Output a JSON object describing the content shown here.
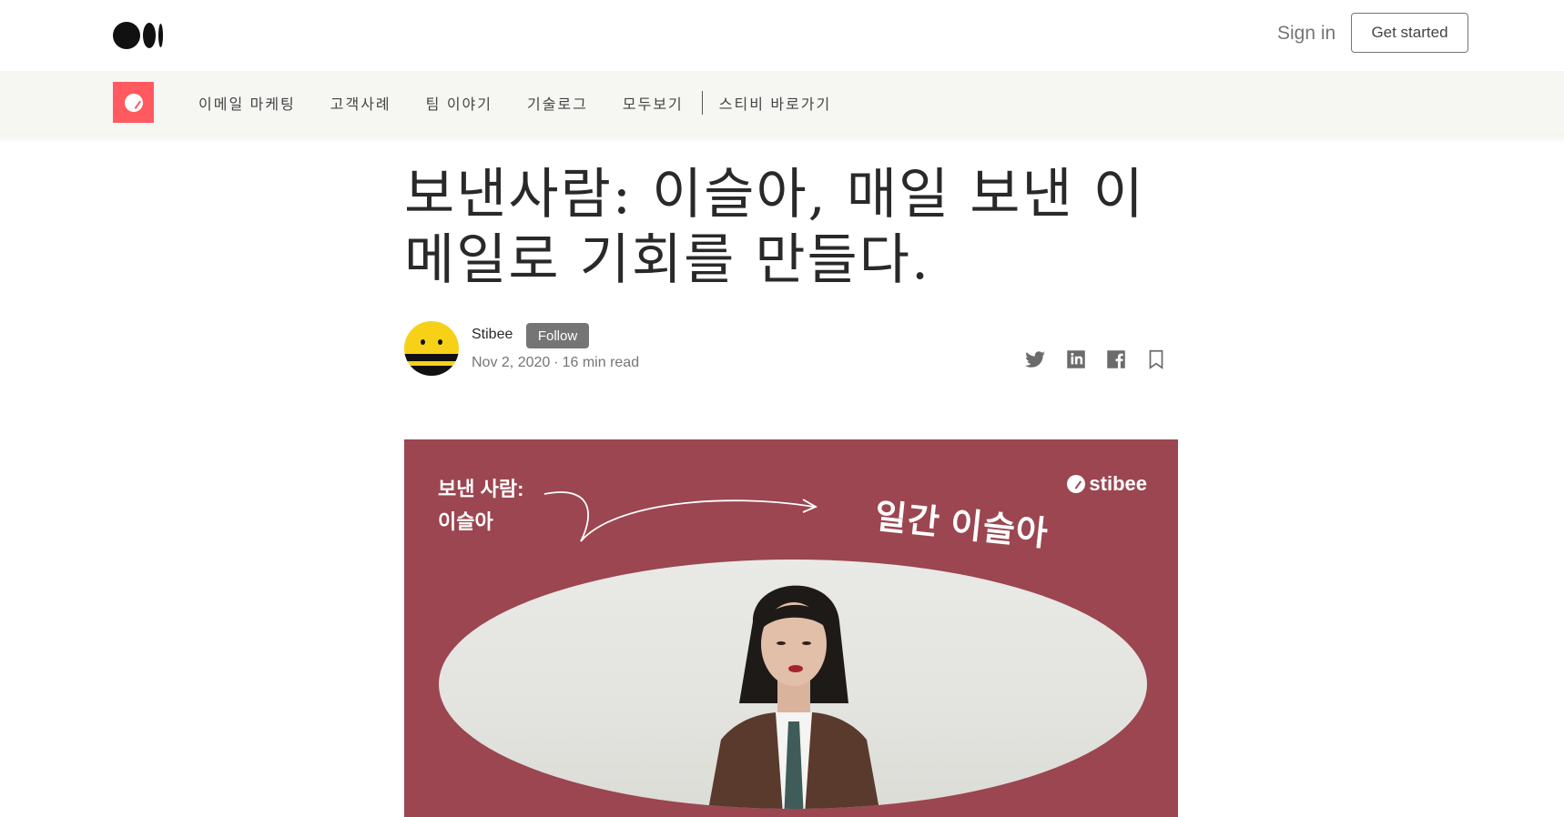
{
  "header": {
    "signin_label": "Sign in",
    "get_started_label": "Get started"
  },
  "publication_nav": {
    "items": [
      "이메일 마케팅",
      "고객사례",
      "팀 이야기",
      "기술로그",
      "모두보기"
    ],
    "external_link": "스티비 바로가기"
  },
  "article": {
    "title": "보낸사람: 이슬아, 매일 보낸 이메일로 기회를 만들다.",
    "author": {
      "name": "Stibee",
      "follow_label": "Follow",
      "date": "Nov 2, 2020",
      "read_time": "16 min read",
      "meta_separator": "·"
    },
    "share_icons": [
      "twitter-icon",
      "linkedin-icon",
      "facebook-icon",
      "bookmark-icon"
    ]
  },
  "hero_image": {
    "left_text_line1": "보낸 사람:",
    "left_text_line2": "이슬아",
    "brand": "stibee",
    "headline": "일간 이슬아",
    "background_color": "#9b4650"
  },
  "colors": {
    "publication_accent": "#ff5a5f",
    "nav_background": "#f6f6f3"
  }
}
